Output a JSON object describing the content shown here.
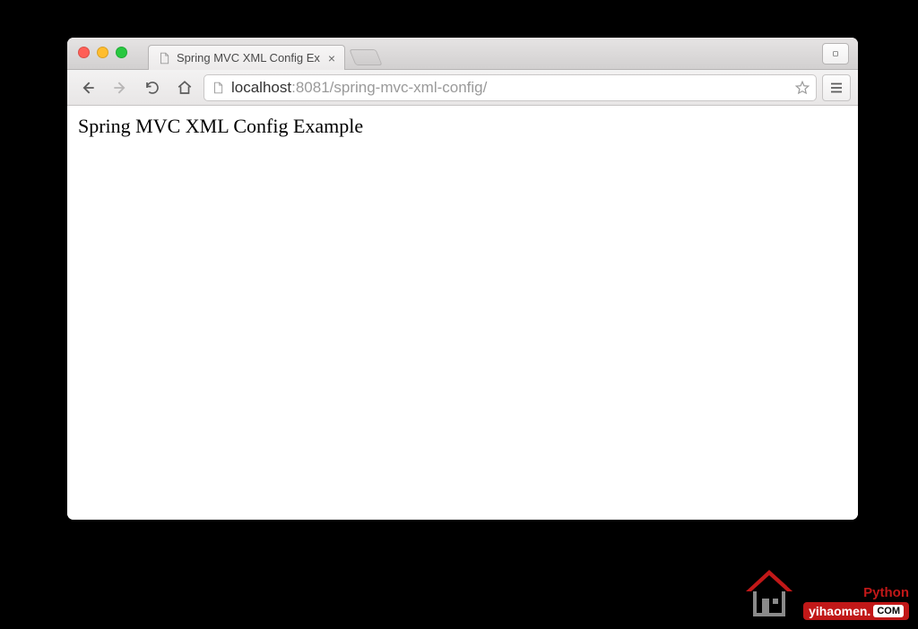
{
  "window": {
    "tab_title": "Spring MVC XML Config Ex"
  },
  "toolbar": {
    "url_host": "localhost",
    "url_port_path": ":8081/spring-mvc-xml-config/"
  },
  "page": {
    "body_text": "Spring MVC XML Config Example"
  },
  "watermark": {
    "label": "Python",
    "domain": "yihaomen.",
    "com": "COM"
  }
}
